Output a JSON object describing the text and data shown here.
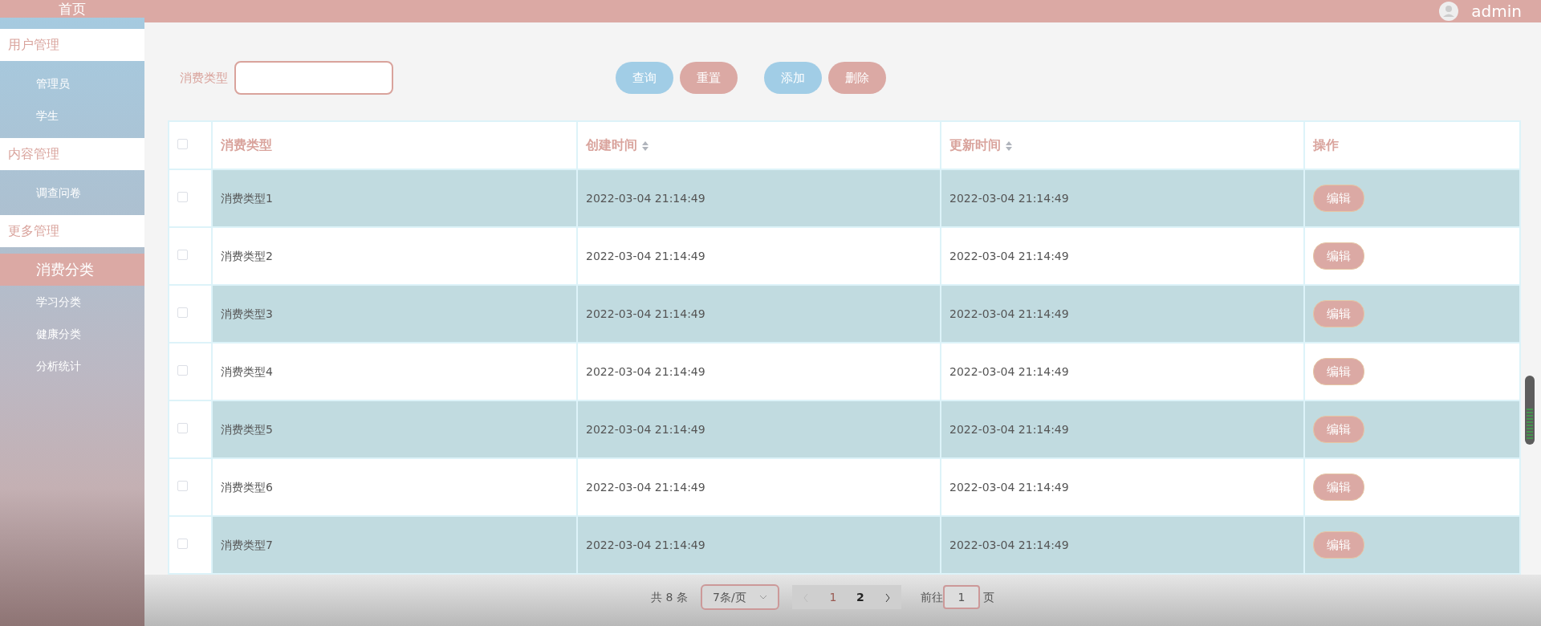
{
  "sidebar": {
    "home": "首页",
    "groups": [
      {
        "title": "用户管理",
        "items": [
          {
            "label": "管理员",
            "selected": false
          },
          {
            "label": "学生",
            "selected": false
          }
        ]
      },
      {
        "title": "内容管理",
        "items": [
          {
            "label": "调查问卷",
            "selected": false
          }
        ]
      },
      {
        "title": "更多管理",
        "items": [
          {
            "label": "消费分类",
            "selected": true
          },
          {
            "label": "学习分类",
            "selected": false
          },
          {
            "label": "健康分类",
            "selected": false
          },
          {
            "label": "分析统计",
            "selected": false
          }
        ]
      }
    ]
  },
  "header": {
    "user": "admin"
  },
  "search": {
    "label": "消费类型",
    "button_groups": [
      [
        {
          "label": "查询",
          "kind": "primary"
        },
        {
          "label": "重置",
          "kind": "secondary"
        }
      ],
      [
        {
          "label": "添加",
          "kind": "primary"
        },
        {
          "label": "删除",
          "kind": "secondary"
        }
      ]
    ]
  },
  "table": {
    "all_checked": false,
    "columns": [
      {
        "label": "消费类型",
        "sortable": false
      },
      {
        "label": "创建时间",
        "sortable": true
      },
      {
        "label": "更新时间",
        "sortable": true
      },
      {
        "label": "操作",
        "sortable": false
      }
    ],
    "rows": [
      {
        "checked": false,
        "name": "消费类型1",
        "created": "2022-03-04 21:14:49",
        "updated": "2022-03-04 21:14:49",
        "action": "编辑"
      },
      {
        "checked": false,
        "name": "消费类型2",
        "created": "2022-03-04 21:14:49",
        "updated": "2022-03-04 21:14:49",
        "action": "编辑"
      },
      {
        "checked": false,
        "name": "消费类型3",
        "created": "2022-03-04 21:14:49",
        "updated": "2022-03-04 21:14:49",
        "action": "编辑"
      },
      {
        "checked": false,
        "name": "消费类型4",
        "created": "2022-03-04 21:14:49",
        "updated": "2022-03-04 21:14:49",
        "action": "编辑"
      },
      {
        "checked": false,
        "name": "消费类型5",
        "created": "2022-03-04 21:14:49",
        "updated": "2022-03-04 21:14:49",
        "action": "编辑"
      },
      {
        "checked": false,
        "name": "消费类型6",
        "created": "2022-03-04 21:14:49",
        "updated": "2022-03-04 21:14:49",
        "action": "编辑"
      },
      {
        "checked": false,
        "name": "消费类型7",
        "created": "2022-03-04 21:14:49",
        "updated": "2022-03-04 21:14:49",
        "action": "编辑"
      }
    ]
  },
  "pagination": {
    "total": "共 8 条",
    "page_size": "7条/页",
    "pages": [
      {
        "label": "1",
        "selected": true
      },
      {
        "label": "2",
        "selected": false
      }
    ],
    "goto_label": "前往",
    "goto_value": "1",
    "goto_suffix": "页"
  }
}
